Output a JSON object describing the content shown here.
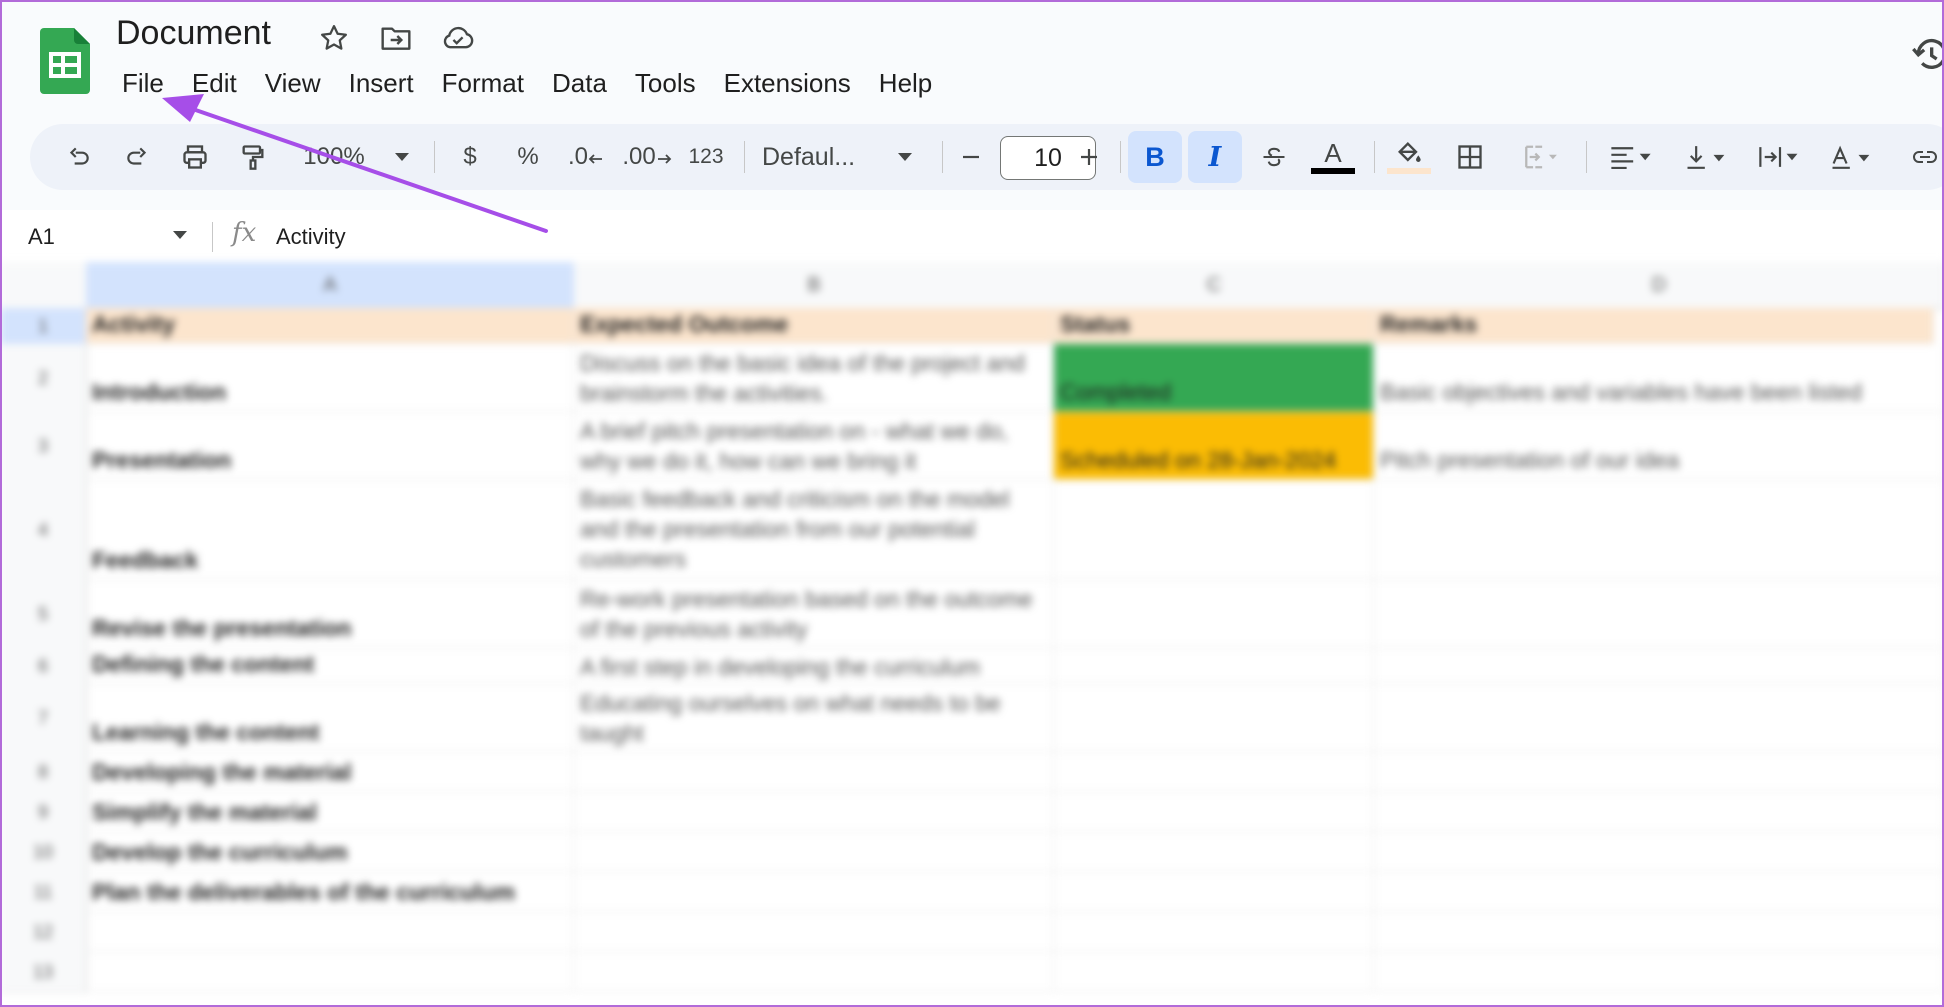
{
  "app": {
    "title": "Document",
    "menu": [
      "File",
      "Edit",
      "View",
      "Insert",
      "Format",
      "Data",
      "Tools",
      "Extensions",
      "Help"
    ]
  },
  "toolbar": {
    "zoom": "100%",
    "currency": "$",
    "percent": "%",
    "decrease_decimal": ".0",
    "increase_decimal": ".00",
    "number_format": "123",
    "font": "Defaul...",
    "font_size": "10",
    "bold": "B",
    "italic": "I",
    "text_color_letter": "A"
  },
  "formula_bar": {
    "cell_ref": "A1",
    "fx": "fx",
    "content": "Activity"
  },
  "sheet": {
    "columns": [
      "A",
      "B",
      "C",
      "D"
    ],
    "header": [
      "Activity",
      "Expected Outcome",
      "Status",
      "Remarks"
    ],
    "rows": [
      [
        "Introduction",
        "Discuss on the basic idea of the project and brainstorm the activities.",
        "Completed",
        "Basic objectives and variables have been listed"
      ],
      [
        "Presentation",
        "A brief pitch presentation on - what we do, why we do it, how can we bring it",
        "Scheduled on 28-Jan-2024",
        "Pitch presentation of our idea"
      ],
      [
        "Feedback",
        "Basic feedback and criticism on the model and the presentation from our potential customers",
        "",
        ""
      ],
      [
        "Revise the presentation",
        "Re-work presentation based on the outcome of the previous activity",
        "",
        ""
      ],
      [
        "Defining the content",
        "A first step in developing the curriculum",
        "",
        ""
      ],
      [
        "Learning the content",
        "Educating ourselves on what needs to be taught",
        "",
        ""
      ],
      [
        "Developing the material",
        "",
        "",
        ""
      ],
      [
        "Simplify the material",
        "",
        "",
        ""
      ],
      [
        "Develop the curriculum",
        "",
        "",
        ""
      ],
      [
        "Plan the deliverables of the curriculum",
        "",
        "",
        ""
      ],
      [
        "",
        "",
        "",
        ""
      ],
      [
        "",
        "",
        "",
        ""
      ]
    ],
    "row_numbers": [
      "1",
      "2",
      "3",
      "4",
      "5",
      "6",
      "7",
      "8",
      "9",
      "10",
      "11",
      "12",
      "13"
    ]
  },
  "colors": {
    "header_fill": "#fce5cd",
    "status_completed": "#34a853",
    "status_scheduled": "#fbbc04",
    "annotation_arrow": "#a64ee8",
    "active_toggle": "#d3e3fd"
  }
}
